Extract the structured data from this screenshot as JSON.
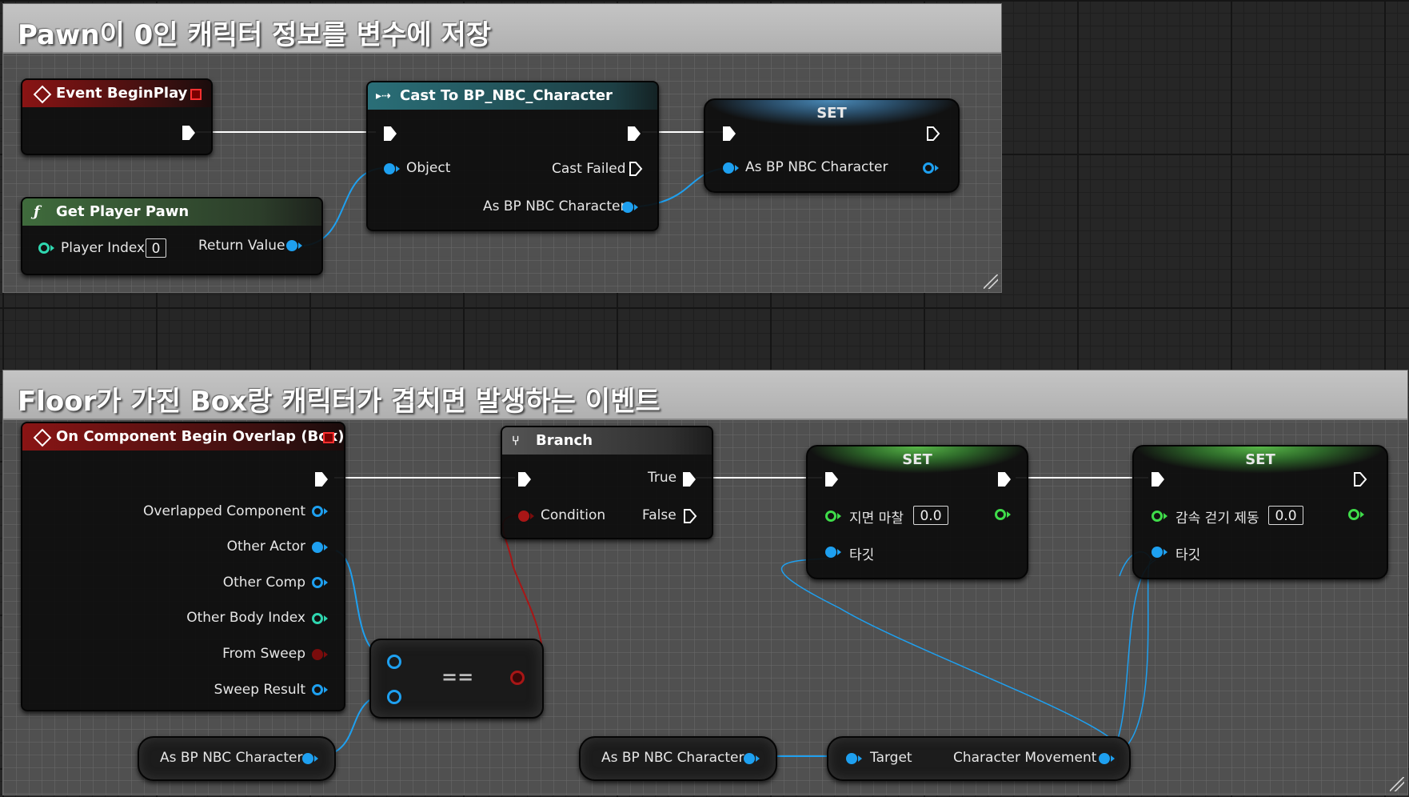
{
  "comments": {
    "top": "Pawn이 0인 캐릭터 정보를 변수에 저장",
    "bottom": "Floor가 가진 Box랑 캐릭터가 겹치면 발생하는 이벤트"
  },
  "event_begin_play": {
    "title": "Event BeginPlay"
  },
  "get_player_pawn": {
    "title": "Get Player Pawn",
    "player_index_label": "Player Index",
    "player_index_value": "0",
    "return_value_label": "Return Value"
  },
  "cast_node": {
    "title": "Cast To BP_NBC_Character",
    "object_label": "Object",
    "cast_failed_label": "Cast Failed",
    "as_label": "As BP NBC Character"
  },
  "set_top": {
    "title": "SET",
    "var_label": "As BP NBC Character"
  },
  "overlap_event": {
    "title": "On Component Begin Overlap (Box)",
    "outputs": [
      "Overlapped Component",
      "Other Actor",
      "Other Comp",
      "Other Body Index",
      "From Sweep",
      "Sweep Result"
    ]
  },
  "branch": {
    "title": "Branch",
    "condition_label": "Condition",
    "true_label": "True",
    "false_label": "False"
  },
  "equals": {
    "symbol": "=="
  },
  "var_getter_1": {
    "label": "As BP NBC Character"
  },
  "var_getter_2": {
    "label": "As BP NBC Character"
  },
  "char_movement": {
    "target_label": "Target",
    "output_label": "Character Movement"
  },
  "set_friction": {
    "title": "SET",
    "var_label": "지면 마찰",
    "value": "0.0",
    "target_label": "타깃"
  },
  "set_braking": {
    "title": "SET",
    "var_label": "감속 걷기 제동",
    "value": "0.0",
    "target_label": "타깃"
  },
  "colors": {
    "object_wire": "#1ea0f0",
    "bool_wire": "#a81616",
    "exec_wire": "#ffffff",
    "event_header": "#8a1414",
    "pure_function_header": "#3f6b3c",
    "cast_header": "#2a6f78"
  }
}
